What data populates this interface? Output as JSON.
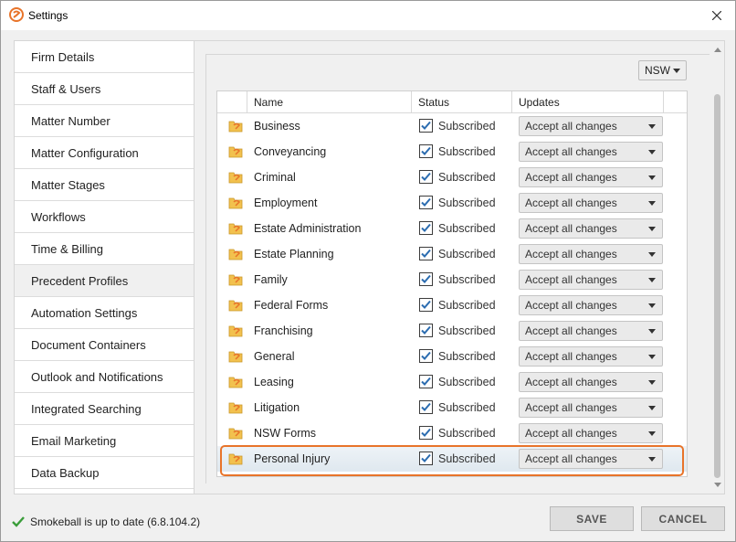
{
  "window": {
    "title": "Settings"
  },
  "sidebar": {
    "items": [
      {
        "label": "Firm Details",
        "active": false
      },
      {
        "label": "Staff & Users",
        "active": false
      },
      {
        "label": "Matter Number",
        "active": false
      },
      {
        "label": "Matter Configuration",
        "active": false
      },
      {
        "label": "Matter Stages",
        "active": false
      },
      {
        "label": "Workflows",
        "active": false
      },
      {
        "label": "Time & Billing",
        "active": false
      },
      {
        "label": "Precedent Profiles",
        "active": true
      },
      {
        "label": "Automation Settings",
        "active": false
      },
      {
        "label": "Document Containers",
        "active": false
      },
      {
        "label": "Outlook and Notifications",
        "active": false
      },
      {
        "label": "Integrated Searching",
        "active": false
      },
      {
        "label": "Email Marketing",
        "active": false
      },
      {
        "label": "Data Backup",
        "active": false
      }
    ]
  },
  "region": {
    "selected": "NSW"
  },
  "table": {
    "headers": {
      "name": "Name",
      "status": "Status",
      "updates": "Updates"
    },
    "rows": [
      {
        "name": "Business",
        "status": "Subscribed",
        "checked": true,
        "update": "Accept all changes"
      },
      {
        "name": "Conveyancing",
        "status": "Subscribed",
        "checked": true,
        "update": "Accept all changes"
      },
      {
        "name": "Criminal",
        "status": "Subscribed",
        "checked": true,
        "update": "Accept all changes"
      },
      {
        "name": "Employment",
        "status": "Subscribed",
        "checked": true,
        "update": "Accept all changes"
      },
      {
        "name": "Estate Administration",
        "status": "Subscribed",
        "checked": true,
        "update": "Accept all changes"
      },
      {
        "name": "Estate Planning",
        "status": "Subscribed",
        "checked": true,
        "update": "Accept all changes"
      },
      {
        "name": "Family",
        "status": "Subscribed",
        "checked": true,
        "update": "Accept all changes"
      },
      {
        "name": "Federal Forms",
        "status": "Subscribed",
        "checked": true,
        "update": "Accept all changes"
      },
      {
        "name": "Franchising",
        "status": "Subscribed",
        "checked": true,
        "update": "Accept all changes"
      },
      {
        "name": "General",
        "status": "Subscribed",
        "checked": true,
        "update": "Accept all changes"
      },
      {
        "name": "Leasing",
        "status": "Subscribed",
        "checked": true,
        "update": "Accept all changes"
      },
      {
        "name": "Litigation",
        "status": "Subscribed",
        "checked": true,
        "update": "Accept all changes"
      },
      {
        "name": "NSW Forms",
        "status": "Subscribed",
        "checked": true,
        "update": "Accept all changes"
      },
      {
        "name": "Personal Injury",
        "status": "Subscribed",
        "checked": true,
        "update": "Accept all changes",
        "highlighted": true
      }
    ]
  },
  "status_bar": {
    "text": "Smokeball is up to date (6.8.104.2)"
  },
  "buttons": {
    "save": "SAVE",
    "cancel": "CANCEL"
  },
  "colors": {
    "accent": "#e8742a",
    "check_blue": "#2b6cb0",
    "folder_yellow": "#f2c14e",
    "status_green": "#3a9d3a"
  },
  "icons": {
    "app": "smokeball-logo-icon",
    "close": "close-icon",
    "precedent": "precedent-folder-icon",
    "status": "checkmark-icon"
  }
}
